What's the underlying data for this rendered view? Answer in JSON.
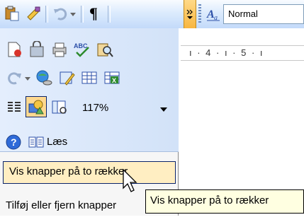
{
  "toolbar": {
    "icons": [
      "paste-icon",
      "format-painter-icon",
      "undo-icon",
      "undo-dropdown-icon",
      "show-formatting-icon",
      "toolbar-options-icon",
      "styles-icon"
    ],
    "pilcrow": "¶",
    "style_value": "Normal"
  },
  "ruler": {
    "text": "ı · 4 · ı · 5 · ı"
  },
  "popup": {
    "zoom": "117%",
    "laes_label": "Læs",
    "vis_row": "Vis knapper på to rækker",
    "tilfoj_row": "Tilføj eller fjern knapper"
  },
  "tooltip": {
    "text": "Vis knapper på to rækker"
  },
  "colors": {
    "highlight": "#ffeec2",
    "tooltip_bg": "#ffffe1",
    "toolbar_bg": "#c3dafa"
  }
}
